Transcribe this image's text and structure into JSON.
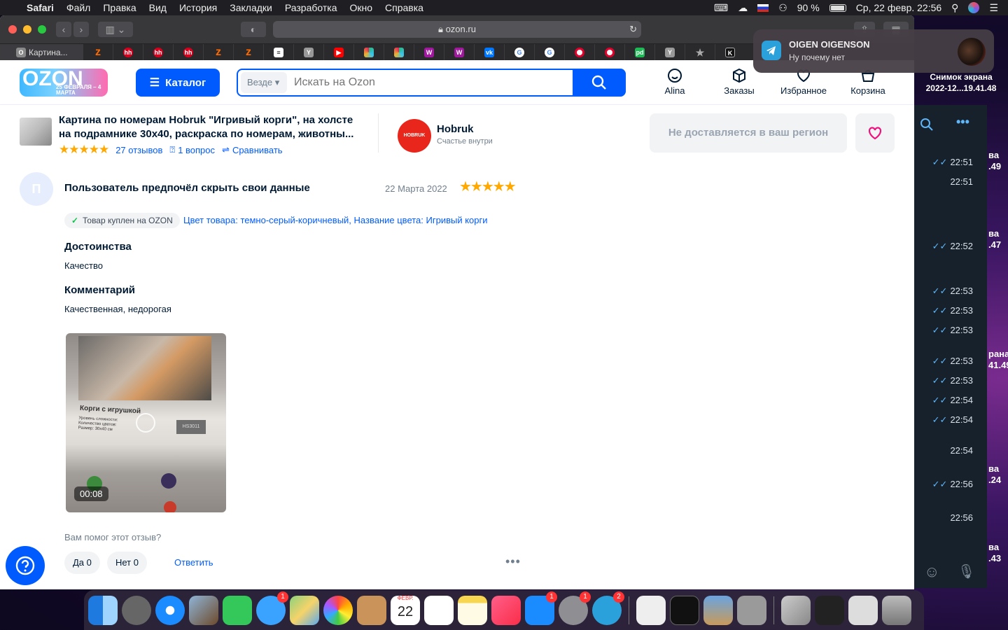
{
  "menubar": {
    "app": "Safari",
    "items": [
      "Файл",
      "Правка",
      "Вид",
      "История",
      "Закладки",
      "Разработка",
      "Окно",
      "Справка"
    ],
    "battery": "90 %",
    "datetime": "Ср, 22 февр.  22:56"
  },
  "browser": {
    "url": "ozon.ru",
    "first_tab": "Картина...",
    "tab_favicons": [
      "ozon-tab",
      "hh-tab",
      "hh-tab",
      "hh-tab",
      "ozon-tab",
      "ozon-tab",
      "notes-tab",
      "yandex-tab",
      "youtube-tab",
      "slack-tab",
      "slack-tab",
      "wildberries-tab",
      "wildberries-tab",
      "vk-tab",
      "google-tab",
      "google-tab",
      "ozon-tab",
      "ozon-tab",
      "pd-tab",
      "yandex-tab",
      "star-tab",
      "k-tab"
    ]
  },
  "notification": {
    "title": "OIGEN OIGENSON",
    "body": "Ну почему нет"
  },
  "ozon": {
    "logo_text": "OZON",
    "promo": "25 ФЕВРАЛЯ – 4 МАРТА",
    "catalog": "Каталог",
    "search_scope": "Везде",
    "search_placeholder": "Искать на Ozon",
    "nav": {
      "profile": "Alina",
      "orders": "Заказы",
      "favorites": "Избранное",
      "cart": "Корзина"
    }
  },
  "product": {
    "title_line1": "Картина по номерам Hobruk \"Игривый корги\", на холсте",
    "title_line2": "на подрамнике 30х40, раскраска по номерам, животны...",
    "stars": "★★★★★",
    "reviews": "27 отзывов",
    "questions": "1 вопрос",
    "compare": "Сравнивать",
    "seller_name": "Hobruk",
    "seller_tagline": "Счастье внутри",
    "seller_logo_text": "HOBRUK",
    "delivery": "Не доставляется в ваш регион"
  },
  "review": {
    "avatar_letter": "П",
    "author": "Пользователь предпочёл скрыть свои данные",
    "date": "22 Марта 2022",
    "stars": "★★★★★",
    "bought": "Товар куплен на OZON",
    "variant": "Цвет товара: темно-серый-коричневый, Название цвета: Игривый корги",
    "pros_title": "Достоинства",
    "pros_text": "Качество",
    "comment_title": "Комментарий",
    "comment_text": "Качественная, недорогая",
    "media_caption": "Корги с игрушкой",
    "media_spec1": "Уровень сложности:",
    "media_spec2": "Количество цветов:",
    "media_spec3": "Размер: 30х40 см",
    "media_code": "HS3011",
    "video_duration": "00:08",
    "helpful_q": "Вам помог этот отзыв?",
    "yes": "Да 0",
    "no": "Нет 0",
    "reply": "Ответить"
  },
  "telegram": {
    "times": [
      "22:51",
      "22:51",
      "22:52",
      "22:53",
      "22:53",
      "22:53",
      "22:53",
      "22:53",
      "22:54",
      "22:54",
      "22:54",
      "22:56",
      "22:56"
    ]
  },
  "desktop": {
    "screenshot_label": "Снимок экрана 2022-12...19.41.48",
    "edge_texts": [
      "ва",
      ".49",
      "ва",
      ".47",
      "рана",
      "41.49",
      "ва",
      ".24",
      "ва",
      ".43"
    ]
  },
  "dock": {
    "calendar_month": "ФЕВР.",
    "calendar_day": "22",
    "messages_badge": "1",
    "appstore_badge": "1",
    "settings_badge": "1",
    "telegram_badge": "2"
  }
}
